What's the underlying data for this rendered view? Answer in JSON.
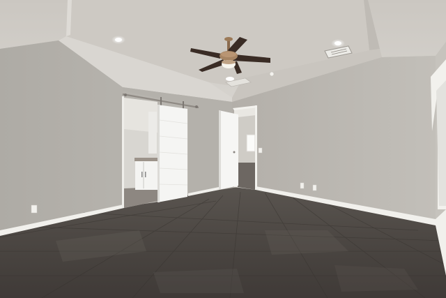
{
  "scene": {
    "subject": "empty-bedroom",
    "objects": [
      "tray-ceiling",
      "ceiling-fan",
      "recessed-lights",
      "air-vent",
      "smoke-detector",
      "sliding-barn-door",
      "bathroom-vanity",
      "open-door",
      "hallway",
      "window",
      "electrical-outlets",
      "light-switch",
      "white-baseboards",
      "tile-floor"
    ]
  },
  "colors": {
    "ceiling": "#cfcbc5",
    "wall_left": "#b6b3ad",
    "wall_back": "#b0aca6",
    "wall_right": "#b9b6b0",
    "trim": "#f4f3ef",
    "floor": "#4a4541",
    "fan_blades": "#3c2e27"
  }
}
